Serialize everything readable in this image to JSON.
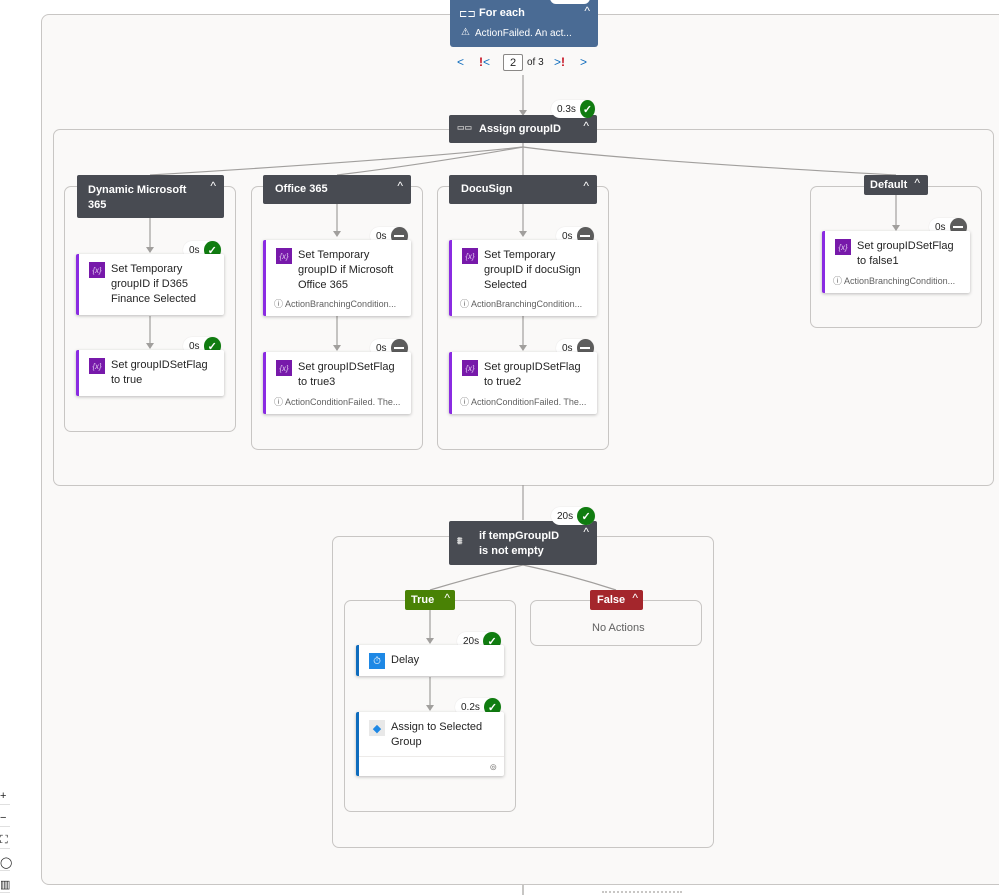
{
  "foreach": {
    "title": "For each",
    "error": "ActionFailed. An act...",
    "pager": {
      "current": "2",
      "of_label": "of 3"
    }
  },
  "switch": {
    "title": "Assign groupID",
    "duration": "0.3s",
    "status": "succeeded",
    "cases": [
      {
        "label": "Dynamic Microsoft 365",
        "actions": [
          {
            "title": "Set Temporary groupID if D365 Finance Selected",
            "duration": "0s",
            "status": "succeeded",
            "message": ""
          },
          {
            "title": "Set groupIDSetFlag to true",
            "duration": "0s",
            "status": "succeeded",
            "message": ""
          }
        ]
      },
      {
        "label": "Office 365",
        "actions": [
          {
            "title": "Set Temporary groupID if Microsoft Office 365",
            "duration": "0s",
            "status": "skipped",
            "message": "ActionBranchingCondition..."
          },
          {
            "title": "Set groupIDSetFlag to true3",
            "duration": "0s",
            "status": "skipped",
            "message": "ActionConditionFailed. The..."
          }
        ]
      },
      {
        "label": "DocuSign",
        "actions": [
          {
            "title": "Set Temporary groupID if docuSign Selected",
            "duration": "0s",
            "status": "skipped",
            "message": "ActionBranchingCondition..."
          },
          {
            "title": "Set groupIDSetFlag to true2",
            "duration": "0s",
            "status": "skipped",
            "message": "ActionConditionFailed. The..."
          }
        ]
      },
      {
        "label": "Default",
        "actions": [
          {
            "title": "Set groupIDSetFlag to false1",
            "duration": "0s",
            "status": "skipped",
            "message": "ActionBranchingCondition..."
          }
        ]
      }
    ]
  },
  "condition": {
    "title": "if tempGroupID is not empty",
    "duration": "20s",
    "status": "succeeded",
    "true_label": "True",
    "false_label": "False",
    "false_empty": "No Actions",
    "true_actions": [
      {
        "title": "Delay",
        "duration": "20s",
        "status": "succeeded"
      },
      {
        "title": "Assign to Selected Group",
        "duration": "0.2s",
        "status": "succeeded"
      }
    ]
  },
  "zoom_controls": [
    "+",
    "−",
    "⛶",
    "◯",
    "▥"
  ],
  "colors": {
    "header": "#484b52",
    "foreach": "#4a6b94",
    "success": "#107c10",
    "skipped": "#5c5c5c",
    "true": "#498205",
    "false": "#a4262c",
    "variable": "#7719aa"
  }
}
